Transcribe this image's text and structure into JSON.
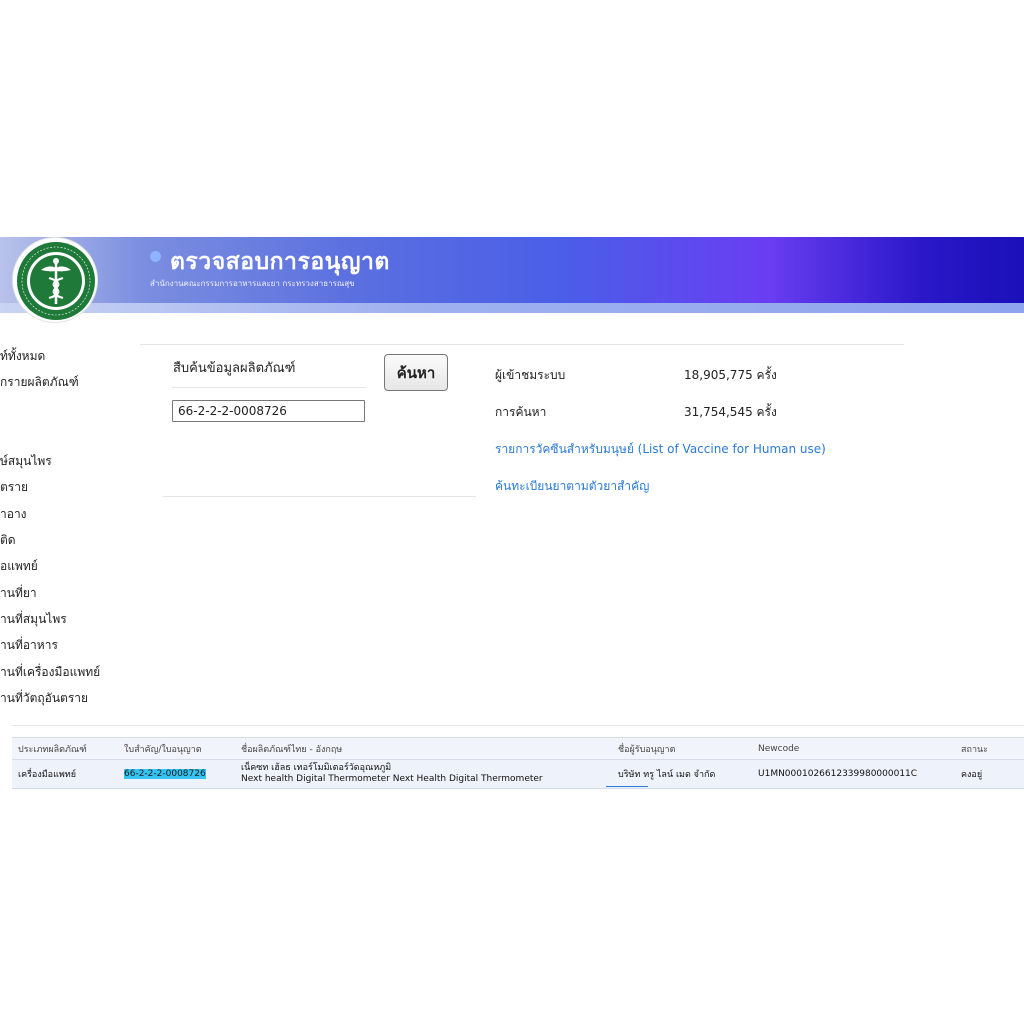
{
  "header": {
    "title": "ตรวจสอบการอนุญาต",
    "subtitle": "สำนักงานคณะกรรมการอาหารและยา กระทรวงสาธารณสุข",
    "logo_text": "กระทรวงสาธารณสุข MINISTRY OF PUBLIC HEALTH"
  },
  "sidebar": {
    "items": [
      {
        "label": "ท์ทั้งหมด"
      },
      {
        "label": "กรายผลิตภัณฑ์"
      },
      {
        "label": "ษ์สมุนไพร"
      },
      {
        "label": "ตราย"
      },
      {
        "label": "ำอาง"
      },
      {
        "label": "ติด"
      },
      {
        "label": "อแพทย์"
      },
      {
        "label": "านที่ยา"
      },
      {
        "label": "านที่สมุนไพร"
      },
      {
        "label": "านที่อาหาร"
      },
      {
        "label": "านที่เครื่องมือแพทย์"
      },
      {
        "label": "านที่วัตถุอันตราย"
      }
    ]
  },
  "search": {
    "heading": "สืบค้นข้อมูลผลิตภัณฑ์",
    "value": "66-2-2-2-0008726",
    "button_label": "ค้นหา"
  },
  "stats": {
    "visitors_label": "ผู้เข้าชมระบบ",
    "visitors_value": "18,905,775 ครั้ง",
    "searches_label": "การค้นหา",
    "searches_value": "31,754,545 ครั้ง"
  },
  "links": {
    "vaccine": "รายการวัคซีนสำหรับมนุษย์ (List of Vaccine for Human use)",
    "drug_search": "ค้นทะเบียนยาตามตัวยาสำคัญ"
  },
  "table": {
    "headers": [
      "ประเภทผลิตภัณฑ์",
      "ใบสำคัญ/ใบอนุญาต",
      "ชื่อผลิตภัณฑ์ไทย - อังกฤษ",
      "ชื่อผู้รับอนุญาต",
      "Newcode",
      "สถานะ"
    ],
    "rows": [
      {
        "type": "เครื่องมือแพทย์",
        "license": "66-2-2-2-0008726",
        "name_th": "เน็คซท เฮ้ลธ เทอร์โมมิเตอร์วัดอุณหภูมิ",
        "name_en": "Next health Digital Thermometer Next Health Digital Thermometer",
        "licensee": "บริษัท ทรู ไลน์ เมด จำกัด",
        "newcode": "U1MN0001026612339980000011C",
        "status": "คงอยู่"
      }
    ]
  },
  "colors": {
    "banner_start": "#b8c2ea",
    "banner_mid": "#4a5ee8",
    "banner_end": "#1a10b8",
    "link": "#2a7ad8",
    "highlight": "#34c3f2",
    "logo_green": "#1f7a3a"
  }
}
